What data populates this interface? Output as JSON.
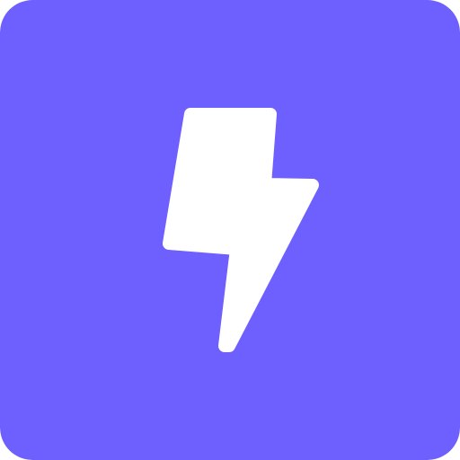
{
  "icon": {
    "name": "lightning-bolt-icon",
    "background_color": "#6E5FFF",
    "glyph_color": "#FFFFFF"
  }
}
